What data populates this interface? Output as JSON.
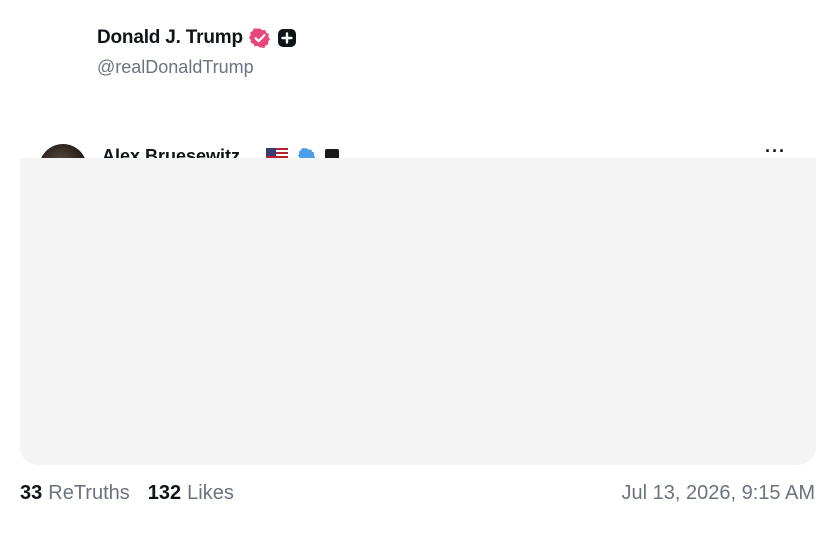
{
  "post": {
    "author": {
      "display_name": "Donald J. Trump",
      "handle": "@realDonaldTrump",
      "verified_icon": "verified-badge-pink",
      "extra_icon": "plus-badge"
    },
    "quoted": {
      "display_name": "Alex Bruesewitz",
      "flag_icon": "us-flag-icon",
      "verified_icon": "verified-badge-blue",
      "more_label": "···"
    },
    "stats": {
      "retruths_count": "33",
      "retruths_label": "ReTruths",
      "likes_count": "132",
      "likes_label": "Likes"
    },
    "timestamp": "Jul 13, 2026, 9:15 AM"
  },
  "colors": {
    "verified_pink": "#e8457a",
    "verified_blue": "#4b9ee8",
    "muted_text": "#6b7280",
    "card_bg": "#f4f4f5"
  }
}
